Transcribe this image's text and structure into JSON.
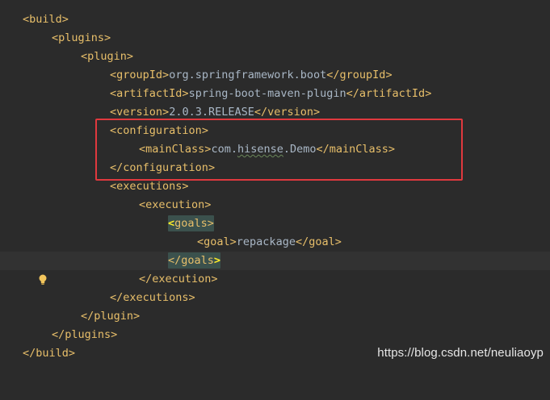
{
  "editor": {
    "lines": {
      "l1": {
        "open": "<",
        "tag": "build",
        "close": ">"
      },
      "l2": {
        "open": "<",
        "tag": "plugins",
        "close": ">"
      },
      "l3": {
        "open": "<",
        "tag": "plugin",
        "close": ">"
      },
      "l4": {
        "open": "<",
        "tag": "groupId",
        "close": ">",
        "text": "org.springframework.boot",
        "end_open": "</",
        "end_tag": "groupId",
        "end_close": ">"
      },
      "l5": {
        "open": "<",
        "tag": "artifactId",
        "close": ">",
        "text": "spring-boot-maven-plugin",
        "end_open": "</",
        "end_tag": "artifactId",
        "end_close": ">"
      },
      "l6": {
        "open": "<",
        "tag": "version",
        "close": ">",
        "text": "2.0.3.RELEASE",
        "end_open": "</",
        "end_tag": "version",
        "end_close": ">"
      },
      "l7": {
        "open": "<",
        "tag": "configuration",
        "close": ">"
      },
      "l8": {
        "open": "<",
        "tag": "mainClass",
        "close": ">",
        "text_a": "com.",
        "text_b": "hisense",
        "text_c": ".Demo",
        "end_open": "</",
        "end_tag": "mainClass",
        "end_close": ">"
      },
      "l9": {
        "open": "</",
        "tag": "configuration",
        "close": ">"
      },
      "l10": {
        "open": "<",
        "tag": "executions",
        "close": ">"
      },
      "l11": {
        "open": "<",
        "tag": "execution",
        "close": ">"
      },
      "l12": {
        "open": "<",
        "tag": "goals",
        "close": ">"
      },
      "l13": {
        "open": "<",
        "tag": "goal",
        "close": ">",
        "text": "repackage",
        "end_open": "</",
        "end_tag": "goal",
        "end_close": ">"
      },
      "l14": {
        "open": "</",
        "tag": "goals",
        "close": ">"
      },
      "l15": {
        "open": "</",
        "tag": "execution",
        "close": ">"
      },
      "l16": {
        "open": "</",
        "tag": "executions",
        "close": ">"
      },
      "l17": {
        "open": "</",
        "tag": "plugin",
        "close": ">"
      },
      "l18": {
        "open": "</",
        "tag": "plugins",
        "close": ">"
      },
      "l19": {
        "open": "</",
        "tag": "build",
        "close": ">"
      }
    }
  },
  "watermark": "https://blog.csdn.net/neuliaoyp",
  "colors": {
    "background": "#2b2b2b",
    "tag": "#e8bf6a",
    "text": "#a9b7c6",
    "match_highlight": "#3b514d",
    "annotation_box": "#e0393e",
    "bulb": "#f2c55c"
  }
}
